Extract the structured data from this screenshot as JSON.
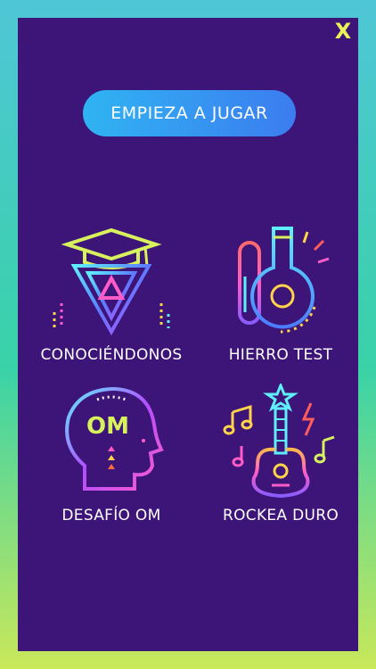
{
  "close_label": "X",
  "cta_label": "EMPIEZA A JUGAR",
  "tiles": [
    {
      "label": "CONOCIÉNDONOS",
      "icon": "graduation-cap-icon"
    },
    {
      "label": "HIERRO TEST",
      "icon": "flask-icon"
    },
    {
      "label": "DESAFÍO OM",
      "icon": "head-icon",
      "icon_text": "OM"
    },
    {
      "label": "ROCKEA DURO",
      "icon": "guitar-icon"
    }
  ],
  "colors": {
    "panel": "#3d1478",
    "cta_start": "#2fb4f2",
    "cta_end": "#3c7cf0",
    "close": "#e9f25a"
  }
}
